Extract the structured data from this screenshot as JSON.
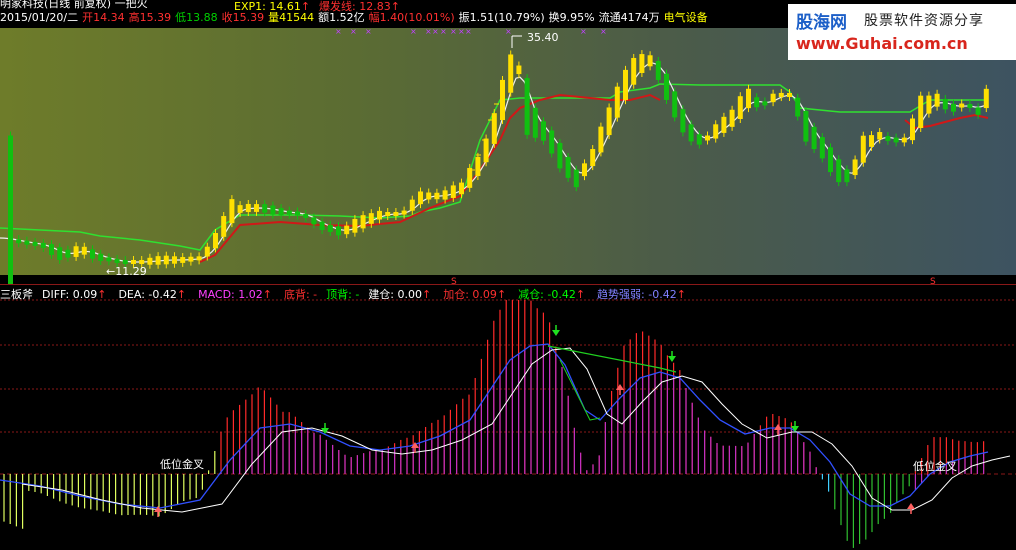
{
  "header": {
    "title": "明家科技(日线 前复权) 一把火",
    "indicator_line": [
      {
        "text": "EXP1: 14.61",
        "color": "#ffff00"
      },
      {
        "text": "↑",
        "color": "#ff3030"
      },
      {
        "text": "爆发线: 12.83",
        "color": "#ff3030"
      },
      {
        "text": "↑",
        "color": "#ff3030"
      }
    ],
    "stats": [
      {
        "text": "2015/01/20/二",
        "color": "#ffffff"
      },
      {
        "text": "开14.34",
        "color": "#ff3030"
      },
      {
        "text": "高15.39",
        "color": "#ff3030"
      },
      {
        "text": "低13.88",
        "color": "#00d000"
      },
      {
        "text": "收15.39",
        "color": "#ff3030"
      },
      {
        "text": "量41544",
        "color": "#ffff00"
      },
      {
        "text": "额1.52亿",
        "color": "#ffffff"
      },
      {
        "text": "幅1.40(10.01%)",
        "color": "#ff3030"
      },
      {
        "text": "振1.51(10.79%)",
        "color": "#ffffff"
      },
      {
        "text": "换9.95%",
        "color": "#ffffff"
      },
      {
        "text": "流通4174万",
        "color": "#ffffff"
      },
      {
        "text": "电气设备",
        "color": "#ffff00"
      }
    ]
  },
  "price_chart": {
    "high_label": "35.40",
    "low_label": "←11.29",
    "marker_s": "S"
  },
  "macd_header": [
    {
      "text": "三板斧",
      "color": "#ffffff"
    },
    {
      "text": "DIFF: 0.09",
      "color": "#ffffff"
    },
    {
      "text": "↑",
      "color": "#ff3030"
    },
    {
      "text": "DEA: -0.42",
      "color": "#ffffff"
    },
    {
      "text": "↑",
      "color": "#ff3030"
    },
    {
      "text": "MACD: 1.02",
      "color": "#ff40ff"
    },
    {
      "text": "↑",
      "color": "#ff3030"
    },
    {
      "text": "底背: -",
      "color": "#ff3030"
    },
    {
      "text": "顶背: -",
      "color": "#00ff00"
    },
    {
      "text": "建仓: 0.00",
      "color": "#ffffff"
    },
    {
      "text": "↑",
      "color": "#ff3030"
    },
    {
      "text": "加仓: 0.09",
      "color": "#ff3030"
    },
    {
      "text": "↑",
      "color": "#ff3030"
    },
    {
      "text": "减仓: -0.42",
      "color": "#00ff00"
    },
    {
      "text": "↑",
      "color": "#ff3030"
    },
    {
      "text": "趋势强弱: -0.42",
      "color": "#8080ff"
    },
    {
      "text": "↑",
      "color": "#ff3030"
    }
  ],
  "macd_chart": {
    "golden_cross_labels": [
      "低位金叉",
      "低位金叉"
    ]
  },
  "watermark": {
    "logo": "股海网",
    "slogan": "股票软件资源分享",
    "url": "www.Guhai.com.cn"
  },
  "colors": {
    "up": "#ff2020",
    "down": "#00e000",
    "yellow_candle": "#ffe000",
    "green_candle": "#10c010",
    "ma_green": "#30e030",
    "ma_red": "#d01818",
    "ma_white": "#f0f0f0",
    "diff_line": "#3050ff",
    "dea_line": "#ffffff",
    "hist_pos": "#ff2a2a",
    "hist_neg": "#40d0ff",
    "hist_pos_inner": "#c030c0",
    "hist_yellow": "#e0ff60",
    "hist_green": "#30c030"
  }
}
